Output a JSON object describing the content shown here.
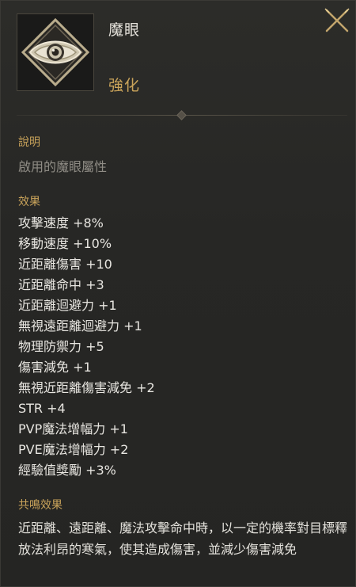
{
  "item": {
    "name": "魔眼",
    "grade": "強化",
    "icon": "magic-eye-icon"
  },
  "description": {
    "title": "說明",
    "text": "啟用的魔眼屬性"
  },
  "effects": {
    "title": "效果",
    "items": [
      "攻擊速度 +8%",
      "移動速度 +10%",
      "近距離傷害 +10",
      "近距離命中 +3",
      "近距離迴避力 +1",
      "無視遠距離迴避力 +1",
      "物理防禦力 +5",
      "傷害減免 +1",
      "無視近距離傷害減免 +2",
      "STR +4",
      "PVP魔法增幅力 +1",
      "PVE魔法增幅力 +2",
      "經驗值獎勵 +3%"
    ]
  },
  "resonance": {
    "title": "共鳴效果",
    "text": "近距離、遠距離、魔法攻擊命中時，以一定的機率對目標釋放法利昂的寒氣，使其造成傷害，並減少傷害減免"
  },
  "colors": {
    "background": "#272725",
    "accent_gold": "#c9a35a",
    "text_primary": "#e8e6e1",
    "text_muted": "#8f8c85"
  }
}
